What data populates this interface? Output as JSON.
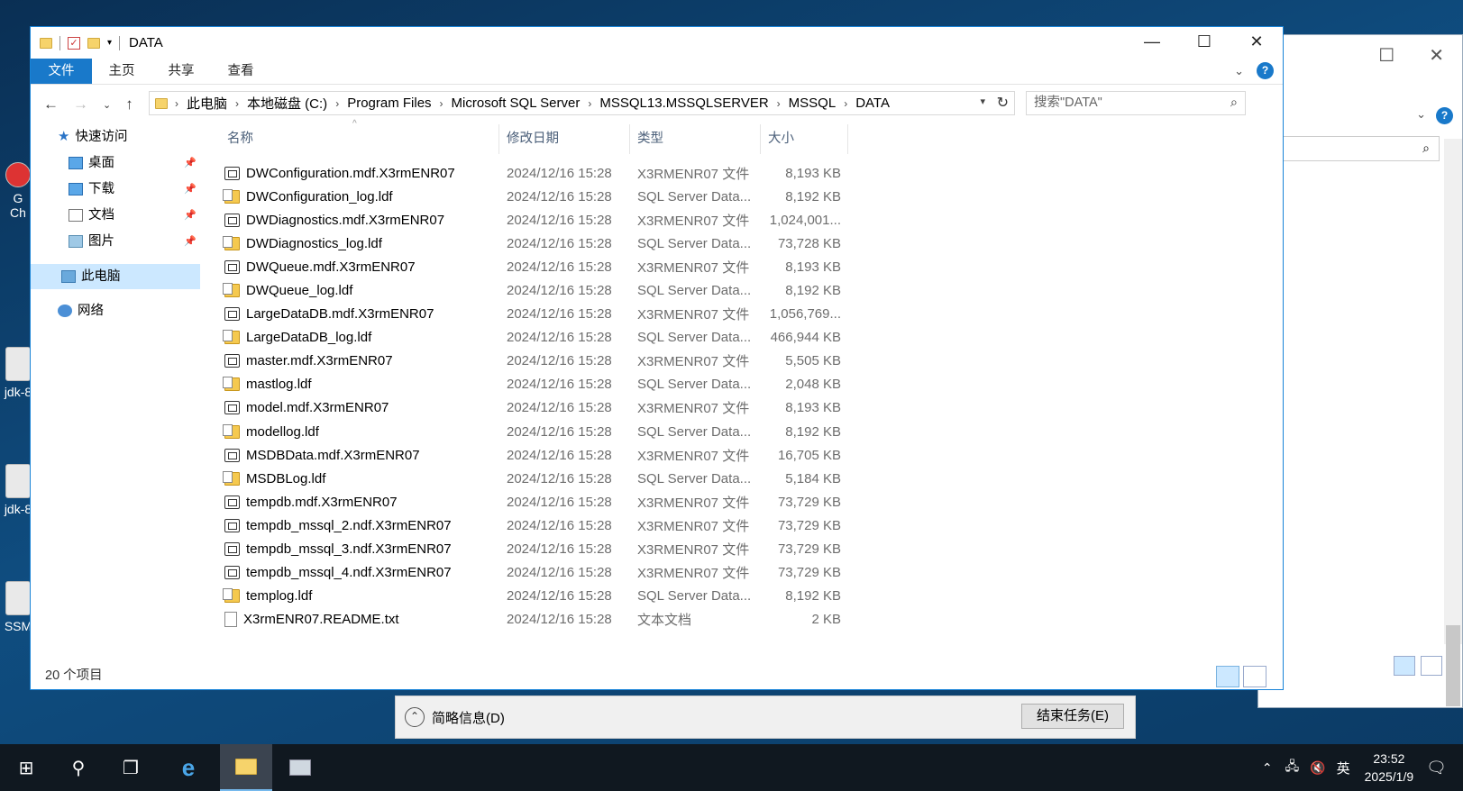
{
  "window": {
    "title": "DATA"
  },
  "ribbon": {
    "tabs": [
      "文件",
      "主页",
      "共享",
      "查看"
    ]
  },
  "address": {
    "crumbs": [
      "此电脑",
      "本地磁盘 (C:)",
      "Program Files",
      "Microsoft SQL Server",
      "MSSQL13.MSSQLSERVER",
      "MSSQL",
      "DATA"
    ]
  },
  "search": {
    "placeholder": "搜索\"DATA\""
  },
  "sidebar": {
    "quick": "快速访问",
    "items": [
      "桌面",
      "下载",
      "文档",
      "图片"
    ],
    "thispc": "此电脑",
    "network": "网络"
  },
  "columns": {
    "name": "名称",
    "date": "修改日期",
    "type": "类型",
    "size": "大小"
  },
  "files": [
    {
      "name": "DWConfiguration.mdf.X3rmENR07",
      "date": "2024/12/16 15:28",
      "type": "X3RMENR07 文件",
      "size": "8,193 KB",
      "icon": "generic"
    },
    {
      "name": "DWConfiguration_log.ldf",
      "date": "2024/12/16 15:28",
      "type": "SQL Server Data...",
      "size": "8,192 KB",
      "icon": "sql"
    },
    {
      "name": "DWDiagnostics.mdf.X3rmENR07",
      "date": "2024/12/16 15:28",
      "type": "X3RMENR07 文件",
      "size": "1,024,001...",
      "icon": "generic"
    },
    {
      "name": "DWDiagnostics_log.ldf",
      "date": "2024/12/16 15:28",
      "type": "SQL Server Data...",
      "size": "73,728 KB",
      "icon": "sql"
    },
    {
      "name": "DWQueue.mdf.X3rmENR07",
      "date": "2024/12/16 15:28",
      "type": "X3RMENR07 文件",
      "size": "8,193 KB",
      "icon": "generic"
    },
    {
      "name": "DWQueue_log.ldf",
      "date": "2024/12/16 15:28",
      "type": "SQL Server Data...",
      "size": "8,192 KB",
      "icon": "sql"
    },
    {
      "name": "LargeDataDB.mdf.X3rmENR07",
      "date": "2024/12/16 15:28",
      "type": "X3RMENR07 文件",
      "size": "1,056,769...",
      "icon": "generic"
    },
    {
      "name": "LargeDataDB_log.ldf",
      "date": "2024/12/16 15:28",
      "type": "SQL Server Data...",
      "size": "466,944 KB",
      "icon": "sql"
    },
    {
      "name": "master.mdf.X3rmENR07",
      "date": "2024/12/16 15:28",
      "type": "X3RMENR07 文件",
      "size": "5,505 KB",
      "icon": "generic"
    },
    {
      "name": "mastlog.ldf",
      "date": "2024/12/16 15:28",
      "type": "SQL Server Data...",
      "size": "2,048 KB",
      "icon": "sql"
    },
    {
      "name": "model.mdf.X3rmENR07",
      "date": "2024/12/16 15:28",
      "type": "X3RMENR07 文件",
      "size": "8,193 KB",
      "icon": "generic"
    },
    {
      "name": "modellog.ldf",
      "date": "2024/12/16 15:28",
      "type": "SQL Server Data...",
      "size": "8,192 KB",
      "icon": "sql"
    },
    {
      "name": "MSDBData.mdf.X3rmENR07",
      "date": "2024/12/16 15:28",
      "type": "X3RMENR07 文件",
      "size": "16,705 KB",
      "icon": "generic"
    },
    {
      "name": "MSDBLog.ldf",
      "date": "2024/12/16 15:28",
      "type": "SQL Server Data...",
      "size": "5,184 KB",
      "icon": "sql"
    },
    {
      "name": "tempdb.mdf.X3rmENR07",
      "date": "2024/12/16 15:28",
      "type": "X3RMENR07 文件",
      "size": "73,729 KB",
      "icon": "generic"
    },
    {
      "name": "tempdb_mssql_2.ndf.X3rmENR07",
      "date": "2024/12/16 15:28",
      "type": "X3RMENR07 文件",
      "size": "73,729 KB",
      "icon": "generic"
    },
    {
      "name": "tempdb_mssql_3.ndf.X3rmENR07",
      "date": "2024/12/16 15:28",
      "type": "X3RMENR07 文件",
      "size": "73,729 KB",
      "icon": "generic"
    },
    {
      "name": "tempdb_mssql_4.ndf.X3rmENR07",
      "date": "2024/12/16 15:28",
      "type": "X3RMENR07 文件",
      "size": "73,729 KB",
      "icon": "generic"
    },
    {
      "name": "templog.ldf",
      "date": "2024/12/16 15:28",
      "type": "SQL Server Data...",
      "size": "8,192 KB",
      "icon": "sql"
    },
    {
      "name": "X3rmENR07.README.txt",
      "date": "2024/12/16 15:28",
      "type": "文本文档",
      "size": "2 KB",
      "icon": "txt"
    }
  ],
  "status": {
    "count": "20 个项目"
  },
  "taskmgr": {
    "brief": "简略信息(D)",
    "end": "结束任务(E)"
  },
  "desktop": {
    "labels": [
      "G",
      "Ch",
      "jdk-8",
      "jdk-8",
      "SSM"
    ]
  },
  "taskbar": {
    "time": "23:52",
    "date": "2025/1/9",
    "ime": "英"
  }
}
